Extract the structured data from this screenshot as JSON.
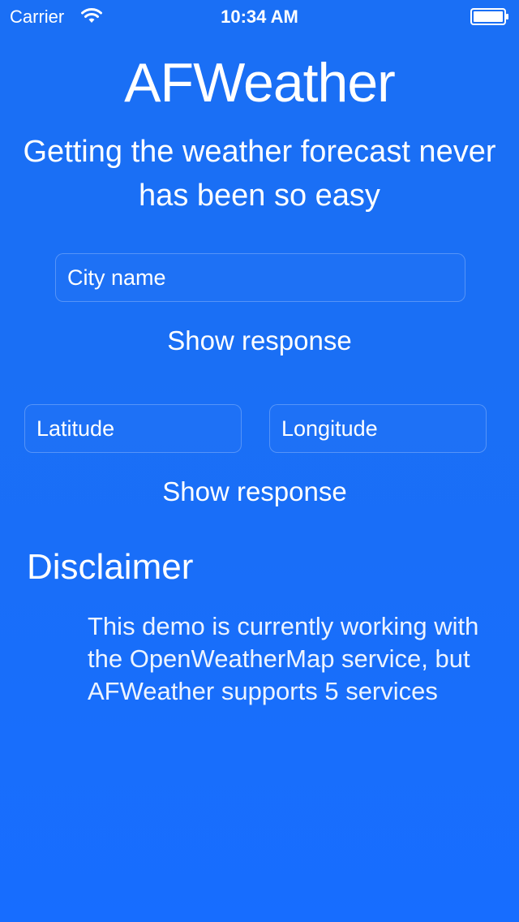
{
  "status_bar": {
    "carrier": "Carrier",
    "time": "10:34 AM",
    "wifi_icon": "wifi-icon",
    "battery_icon": "battery-icon"
  },
  "header": {
    "title": "AFWeather",
    "subtitle": "Getting the weather forecast never has been so easy"
  },
  "city_search": {
    "placeholder": "City name",
    "value": "",
    "button_label": "Show response"
  },
  "coordinate_search": {
    "latitude_placeholder": "Latitude",
    "longitude_placeholder": "Longitude",
    "button_label": "Show response"
  },
  "disclaimer": {
    "title": "Disclaimer",
    "text": "This demo is currently working with the OpenWeatherMap service, but AFWeather supports 5 services"
  },
  "colors": {
    "background": "#1a6ff5",
    "text": "#ffffff"
  }
}
